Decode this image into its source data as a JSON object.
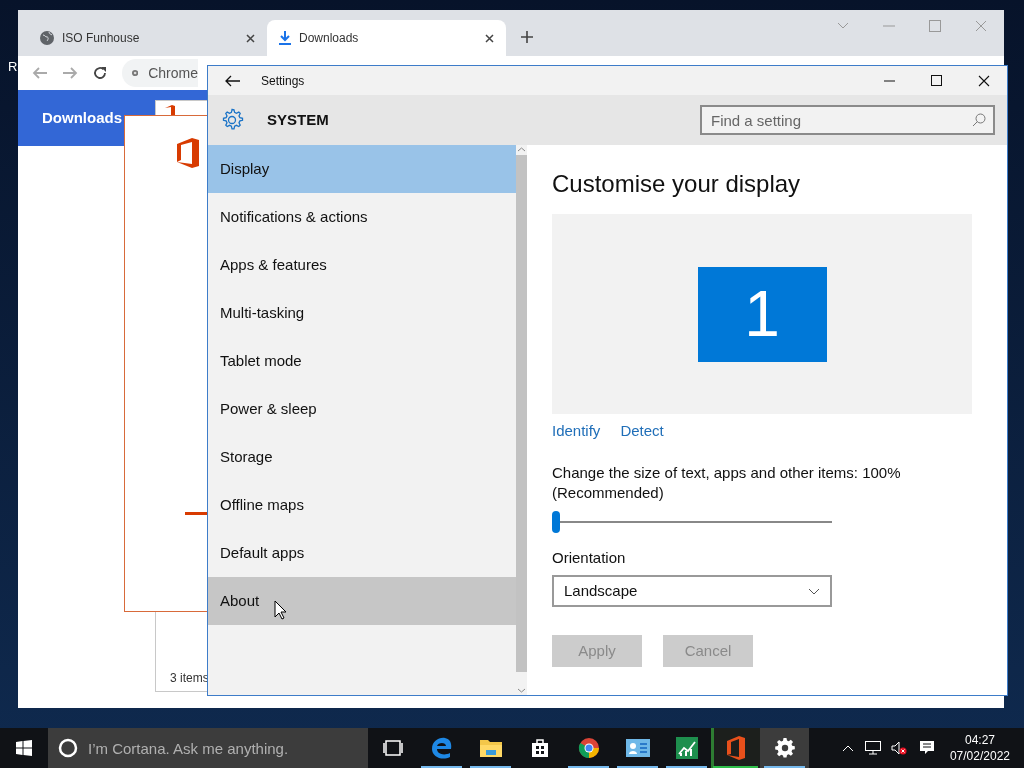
{
  "desktop": {
    "icon_label": "R"
  },
  "browser": {
    "tabs": [
      {
        "label": "ISO Funhouse",
        "kind": "globe",
        "selected": false
      },
      {
        "label": "Downloads",
        "kind": "download",
        "selected": true
      }
    ],
    "address_bar": {
      "value": "Chrome"
    },
    "page_header": "Downloads"
  },
  "background_window": {
    "status": "3 items"
  },
  "settings": {
    "title": "Settings",
    "section": "SYSTEM",
    "search": {
      "placeholder": "Find a setting"
    },
    "nav": [
      {
        "label": "Display",
        "selected": true,
        "hovered": false
      },
      {
        "label": "Notifications & actions",
        "selected": false,
        "hovered": false
      },
      {
        "label": "Apps & features",
        "selected": false,
        "hovered": false
      },
      {
        "label": "Multi-tasking",
        "selected": false,
        "hovered": false
      },
      {
        "label": "Tablet mode",
        "selected": false,
        "hovered": false
      },
      {
        "label": "Power & sleep",
        "selected": false,
        "hovered": false
      },
      {
        "label": "Storage",
        "selected": false,
        "hovered": false
      },
      {
        "label": "Offline maps",
        "selected": false,
        "hovered": false
      },
      {
        "label": "Default apps",
        "selected": false,
        "hovered": false
      },
      {
        "label": "About",
        "selected": false,
        "hovered": true
      }
    ],
    "heading": "Customise your display",
    "monitor_label": "1",
    "links": [
      "Identify",
      "Detect"
    ],
    "scale": {
      "label": "Change the size of text, apps and other items: 100% (Recommended)",
      "level": 0
    },
    "orientation": {
      "label": "Orientation",
      "value": "Landscape"
    },
    "buttons": [
      {
        "label": "Apply",
        "disabled": true
      },
      {
        "label": "Cancel",
        "disabled": true
      }
    ]
  },
  "taskbar": {
    "search": {
      "placeholder": "I’m Cortana. Ask me anything."
    },
    "apps": [
      {
        "kind": "taskview",
        "running": false,
        "selected": false,
        "flashing": false
      },
      {
        "kind": "edge",
        "running": true,
        "selected": false,
        "flashing": false
      },
      {
        "kind": "explorer",
        "running": true,
        "selected": false,
        "flashing": false
      },
      {
        "kind": "store",
        "running": false,
        "selected": false,
        "flashing": false
      },
      {
        "kind": "chrome",
        "running": true,
        "selected": false,
        "flashing": false
      },
      {
        "kind": "card",
        "running": true,
        "selected": false,
        "flashing": false
      },
      {
        "kind": "chart",
        "running": true,
        "selected": false,
        "flashing": false
      },
      {
        "kind": "office",
        "running": true,
        "selected": false,
        "flashing": true
      },
      {
        "kind": "settings",
        "running": true,
        "selected": true,
        "flashing": false
      }
    ],
    "clock": {
      "time": "04:27",
      "date": "07/02/2022"
    }
  }
}
